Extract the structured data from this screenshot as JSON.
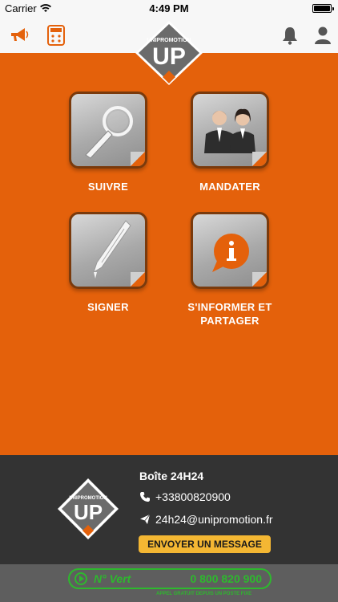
{
  "status_bar": {
    "carrier": "Carrier",
    "time": "4:49 PM"
  },
  "nav": {
    "logo_top_text": "UNIPROMOTION",
    "logo_text": "UP"
  },
  "tiles": [
    {
      "label": "SUIVRE",
      "icon": "magnifier-icon"
    },
    {
      "label": "MANDATER",
      "icon": "people-icon"
    },
    {
      "label": "SIGNER",
      "icon": "pen-icon"
    },
    {
      "label": "S'INFORMER ET\nPARTAGER",
      "icon": "info-bubble-icon"
    }
  ],
  "footer": {
    "title": "Boîte 24H24",
    "phone": "+33800820900",
    "email": "24h24@unipromotion.fr",
    "send_button": "ENVOYER UN MESSAGE",
    "logo_top_text": "UNIPROMOTION",
    "logo_text": "UP"
  },
  "banner": {
    "label": "N° Vert",
    "number": "0 800 820 900",
    "subtext": "APPEL GRATUIT DEPUIS UN POSTE FIXE"
  },
  "colors": {
    "accent": "#e4610b",
    "footer_bg": "#333333",
    "button": "#f4b733",
    "banner_green": "#2eb82e"
  }
}
